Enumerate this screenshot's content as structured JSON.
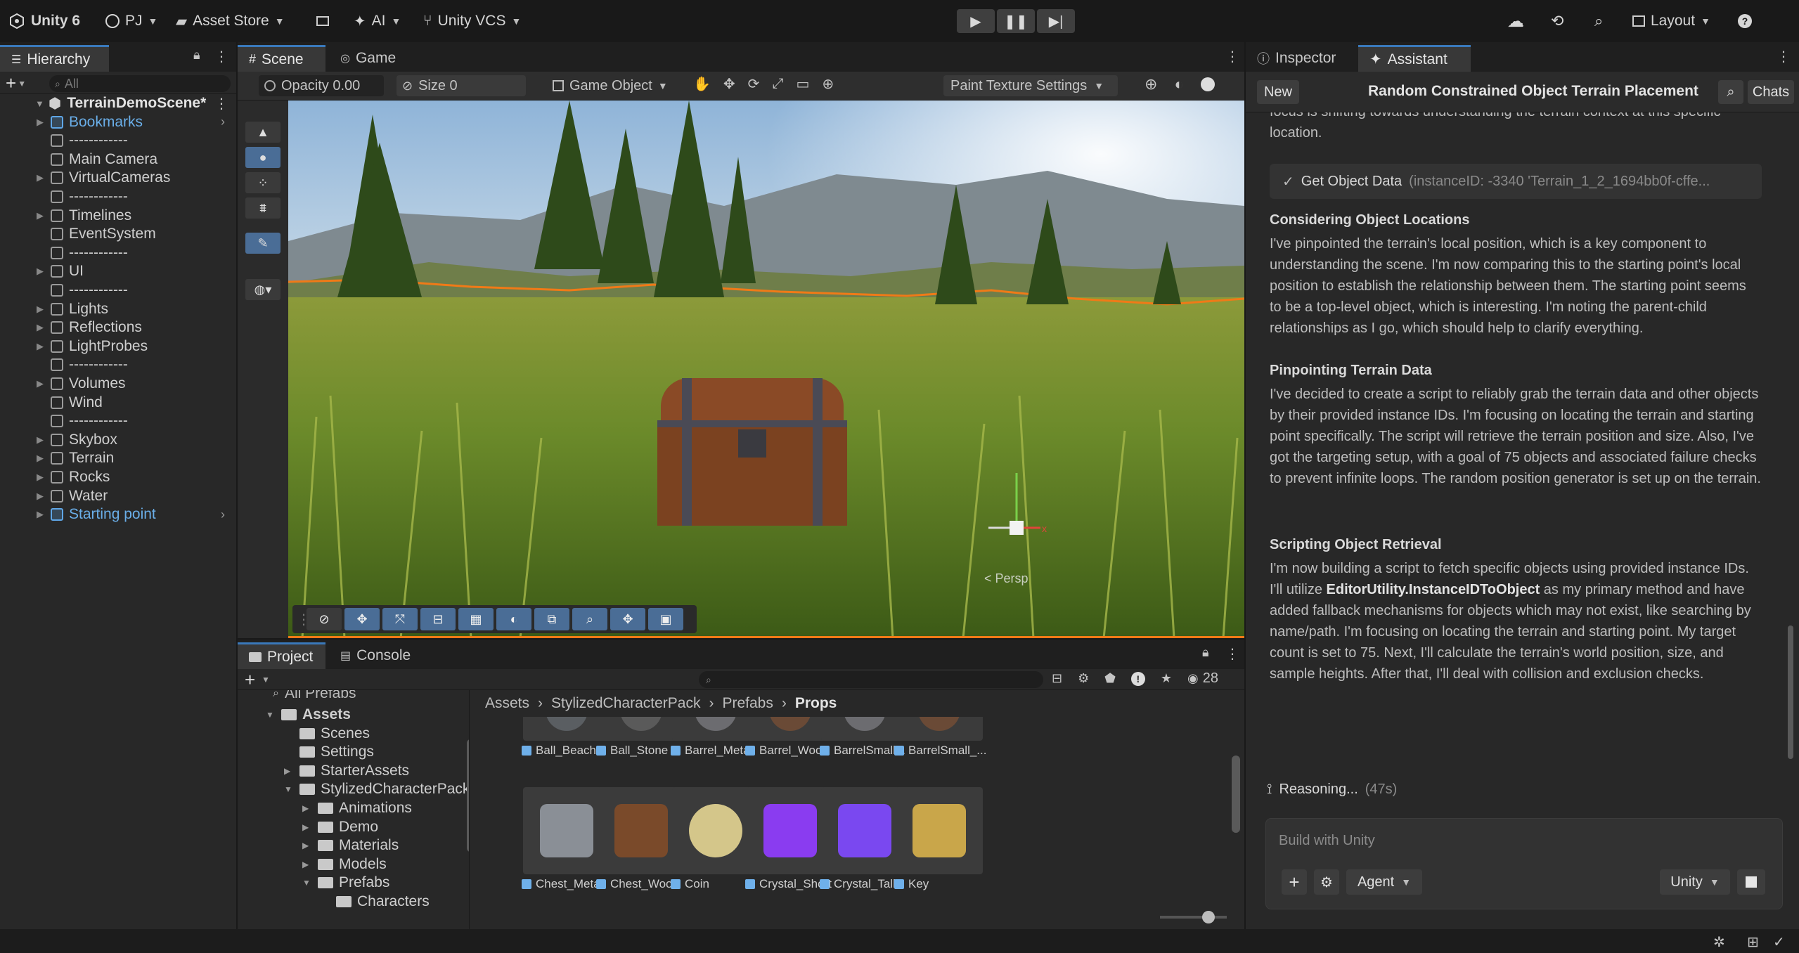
{
  "topbar": {
    "app": "Unity 6",
    "account": "PJ",
    "asset_store": "Asset Store",
    "ai": "AI",
    "vcs": "Unity VCS",
    "layout": "Layout"
  },
  "hierarchy": {
    "tab": "Hierarchy",
    "search_placeholder": "All",
    "scene": "TerrainDemoScene*",
    "items": [
      {
        "label": "Bookmarks",
        "expand": true,
        "style": "blue"
      },
      {
        "label": "------------",
        "expand": false,
        "style": "normal"
      },
      {
        "label": "Main Camera",
        "expand": false,
        "style": "normal"
      },
      {
        "label": "VirtualCameras",
        "expand": true,
        "style": "normal"
      },
      {
        "label": "------------",
        "expand": false,
        "style": "normal"
      },
      {
        "label": "Timelines",
        "expand": true,
        "style": "normal"
      },
      {
        "label": "EventSystem",
        "expand": false,
        "style": "normal"
      },
      {
        "label": "------------",
        "expand": false,
        "style": "normal"
      },
      {
        "label": "UI",
        "expand": true,
        "style": "normal"
      },
      {
        "label": "------------",
        "expand": false,
        "style": "normal"
      },
      {
        "label": "Lights",
        "expand": true,
        "style": "normal"
      },
      {
        "label": "Reflections",
        "expand": true,
        "style": "normal"
      },
      {
        "label": "LightProbes",
        "expand": true,
        "style": "normal"
      },
      {
        "label": "------------",
        "expand": false,
        "style": "normal"
      },
      {
        "label": "Volumes",
        "expand": true,
        "style": "normal"
      },
      {
        "label": "Wind",
        "expand": false,
        "style": "normal"
      },
      {
        "label": "------------",
        "expand": false,
        "style": "normal"
      },
      {
        "label": "Skybox",
        "expand": true,
        "style": "normal"
      },
      {
        "label": "Terrain",
        "expand": true,
        "style": "normal"
      },
      {
        "label": "Rocks",
        "expand": true,
        "style": "normal"
      },
      {
        "label": "Water",
        "expand": true,
        "style": "normal"
      },
      {
        "label": "Starting point",
        "expand": true,
        "style": "blue"
      }
    ]
  },
  "scene": {
    "tab_scene": "Scene",
    "tab_game": "Game",
    "opacity": "Opacity 0.00",
    "size": "Size 0",
    "game_object": "Game Object",
    "paint_settings": "Paint Texture Settings",
    "persp": "< Persp"
  },
  "project": {
    "tab_project": "Project",
    "tab_console": "Console",
    "count": "28",
    "all_prefabs": "All Prefabs",
    "breadcrumb": [
      "Assets",
      "StylizedCharacterPack",
      "Prefabs",
      "Props"
    ],
    "folders": [
      {
        "label": "Assets",
        "indent": 0,
        "expand": "open",
        "bold": true
      },
      {
        "label": "Scenes",
        "indent": 1,
        "expand": "none",
        "bold": false
      },
      {
        "label": "Settings",
        "indent": 1,
        "expand": "none",
        "bold": false
      },
      {
        "label": "StarterAssets",
        "indent": 1,
        "expand": "closed",
        "bold": false
      },
      {
        "label": "StylizedCharacterPack",
        "indent": 1,
        "expand": "open",
        "bold": false
      },
      {
        "label": "Animations",
        "indent": 2,
        "expand": "closed",
        "bold": false
      },
      {
        "label": "Demo",
        "indent": 2,
        "expand": "closed",
        "bold": false
      },
      {
        "label": "Materials",
        "indent": 2,
        "expand": "closed",
        "bold": false
      },
      {
        "label": "Models",
        "indent": 2,
        "expand": "closed",
        "bold": false
      },
      {
        "label": "Prefabs",
        "indent": 2,
        "expand": "open",
        "bold": false
      },
      {
        "label": "Characters",
        "indent": 3,
        "expand": "none",
        "bold": false
      }
    ],
    "row1": [
      "Ball_Beach",
      "Ball_Stone",
      "Barrel_Metal",
      "Barrel_Wood",
      "BarrelSmall...",
      "BarrelSmall_..."
    ],
    "row2": [
      "Chest_Metal",
      "Chest_Wood",
      "Coin",
      "Crystal_Short",
      "Crystal_Tall",
      "Key"
    ]
  },
  "assistant": {
    "tab_inspector": "Inspector",
    "tab_assistant": "Assistant",
    "new": "New",
    "title": "Random Constrained Object Terrain Placement",
    "chats": "Chats",
    "top_text": "focus is shifting towards understanding the terrain context at this specific location.",
    "tool_call": "Get Object Data",
    "tool_args": "(instanceID: -3340 'Terrain_1_2_1694bb0f-cffe...",
    "sections": [
      {
        "head": "Considering Object Locations",
        "body": "I've pinpointed the terrain's local position, which is a key component to understanding the scene. I'm now comparing this to the starting point's local position to establish the relationship between them. The starting point seems to be a top-level object, which is interesting. I'm noting the parent-child relationships as I go, which should help to clarify everything."
      },
      {
        "head": "Pinpointing Terrain Data",
        "body": "I've decided to create a script to reliably grab the terrain data and other objects by their provided instance IDs. I'm focusing on locating the terrain and starting point specifically. The script will retrieve the terrain position and size. Also, I've got the targeting setup, with a goal of 75 objects and associated failure checks to prevent infinite loops. The random position generator is set up on the terrain."
      },
      {
        "head": "Scripting Object Retrieval",
        "body_pre": "I'm now building a script to fetch specific objects using provided instance IDs. I'll utilize ",
        "body_bold": "EditorUtility.InstanceIDToObject",
        "body_post": " as my primary method and have added fallback mechanisms for objects which may not exist, like searching by name/path. I'm focusing on locating the terrain and starting point. My target count is set to 75. Next, I'll calculate the terrain's world position, size, and sample heights. After that, I'll deal with collision and exclusion checks."
      }
    ],
    "reasoning": "Reasoning...",
    "reasoning_time": "(47s)",
    "input_placeholder": "Build with Unity",
    "mode": "Agent",
    "model": "Unity"
  },
  "colors": {
    "accent": "#3a79bb",
    "selection": "#f07a17",
    "link": "#6aaee8"
  }
}
